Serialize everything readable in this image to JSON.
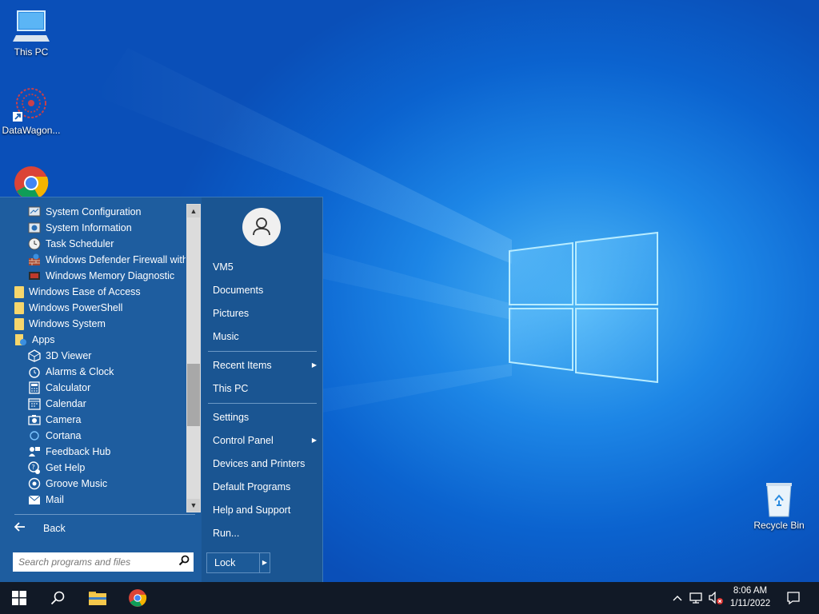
{
  "desktop": {
    "icons": [
      {
        "label": "This PC"
      },
      {
        "label": "DataWagon..."
      },
      {
        "label": ""
      },
      {
        "label": "Recycle Bin"
      }
    ]
  },
  "start_menu": {
    "programs": [
      {
        "label": "System Configuration",
        "icon": "system-configuration-icon"
      },
      {
        "label": "System Information",
        "icon": "system-information-icon"
      },
      {
        "label": "Task Scheduler",
        "icon": "task-scheduler-icon"
      },
      {
        "label": "Windows Defender Firewall with A",
        "icon": "firewall-icon"
      },
      {
        "label": "Windows Memory Diagnostic",
        "icon": "memory-diagnostic-icon"
      },
      {
        "label": "Windows Ease of Access",
        "icon": "folder-icon"
      },
      {
        "label": "Windows PowerShell",
        "icon": "folder-icon"
      },
      {
        "label": "Windows System",
        "icon": "folder-icon"
      },
      {
        "label": "Apps",
        "icon": "apps-folder-icon"
      },
      {
        "label": "3D Viewer",
        "icon": "3d-viewer-icon"
      },
      {
        "label": "Alarms & Clock",
        "icon": "alarm-clock-icon"
      },
      {
        "label": "Calculator",
        "icon": "calculator-icon"
      },
      {
        "label": "Calendar",
        "icon": "calendar-icon"
      },
      {
        "label": "Camera",
        "icon": "camera-icon"
      },
      {
        "label": "Cortana",
        "icon": "cortana-icon"
      },
      {
        "label": "Feedback Hub",
        "icon": "feedback-hub-icon"
      },
      {
        "label": "Get Help",
        "icon": "get-help-icon"
      },
      {
        "label": "Groove Music",
        "icon": "groove-music-icon"
      },
      {
        "label": "Mail",
        "icon": "mail-icon"
      }
    ],
    "back_label": "Back",
    "search_placeholder": "Search programs and files",
    "right_items": {
      "user": "VM5",
      "documents": "Documents",
      "pictures": "Pictures",
      "music": "Music",
      "recent_items": "Recent Items",
      "this_pc": "This PC",
      "settings": "Settings",
      "control_panel": "Control Panel",
      "devices_printers": "Devices and Printers",
      "default_programs": "Default Programs",
      "help_support": "Help and Support",
      "run": "Run..."
    },
    "lock_label": "Lock"
  },
  "taskbar": {
    "time": "8:06 AM",
    "date": "1/11/2022"
  },
  "colors": {
    "accent": "#1e5d9f",
    "taskbar": "#111926"
  }
}
